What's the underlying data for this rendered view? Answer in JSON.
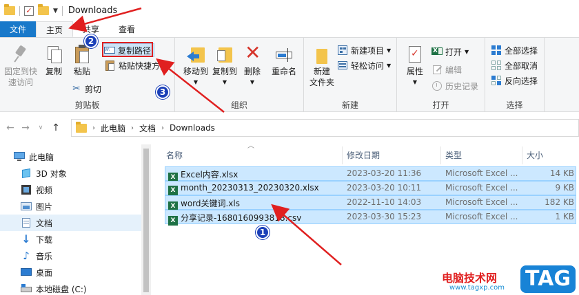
{
  "window": {
    "title": "Downloads"
  },
  "tabs": [
    {
      "label": "文件"
    },
    {
      "label": "主页"
    },
    {
      "label": "共享"
    },
    {
      "label": "查看"
    }
  ],
  "ribbon": {
    "clipboard": {
      "label": "剪贴板",
      "pin": "固定到快速访问",
      "pin_line1": "固定到快",
      "pin_line2": "速访问",
      "copy": "复制",
      "paste": "粘贴",
      "copy_path": "复制路径",
      "paste_shortcut": "粘贴快捷方式",
      "cut": "剪切"
    },
    "organize": {
      "label": "组织",
      "move_to": "移动到",
      "copy_to": "复制到",
      "delete": "删除",
      "rename": "重命名"
    },
    "new": {
      "label": "新建",
      "new_folder_line1": "新建",
      "new_folder_line2": "文件夹",
      "new_item": "新建项目",
      "easy_access": "轻松访问"
    },
    "open": {
      "label": "打开",
      "properties": "属性",
      "open": "打开",
      "edit": "编辑",
      "history": "历史记录"
    },
    "select": {
      "label": "选择",
      "select_all": "全部选择",
      "select_none": "全部取消",
      "invert": "反向选择"
    }
  },
  "address": {
    "crumbs": [
      "此电脑",
      "文档",
      "Downloads"
    ]
  },
  "navpane": {
    "items": [
      {
        "label": "此电脑",
        "icon": "computer-icon"
      },
      {
        "label": "3D 对象",
        "icon": "cube-icon"
      },
      {
        "label": "视频",
        "icon": "video-icon"
      },
      {
        "label": "图片",
        "icon": "picture-icon"
      },
      {
        "label": "文档",
        "icon": "document-icon"
      },
      {
        "label": "下载",
        "icon": "download-icon"
      },
      {
        "label": "音乐",
        "icon": "music-icon"
      },
      {
        "label": "桌面",
        "icon": "desktop-icon"
      },
      {
        "label": "本地磁盘 (C:)",
        "icon": "drive-icon"
      }
    ]
  },
  "filelist": {
    "columns": [
      "名称",
      "修改日期",
      "类型",
      "大小"
    ],
    "rows": [
      {
        "name": "Excel内容.xlsx",
        "date": "2023-03-20 11:36",
        "type": "Microsoft Excel ...",
        "size": "14 KB"
      },
      {
        "name": "month_20230313_20230320.xlsx",
        "date": "2023-03-20 10:11",
        "type": "Microsoft Excel ...",
        "size": "9 KB"
      },
      {
        "name": "word关键词.xls",
        "date": "2022-11-10 14:03",
        "type": "Microsoft Excel ...",
        "size": "182 KB"
      },
      {
        "name": "分享记录-1680160993818.csv",
        "date": "2023-03-30 15:23",
        "type": "Microsoft Excel ...",
        "size": "1 KB"
      }
    ]
  },
  "annotations": {
    "badge1": "1",
    "badge2": "2",
    "badge3": "3",
    "arrow_color": "#e02020",
    "badge_color": "#1a3fb8"
  },
  "watermark": {
    "text": "电脑技术网",
    "url": "www.tagxp.com",
    "tag": "TAG"
  },
  "colors": {
    "file_tab": "#1979ca",
    "selection": "#cce8ff",
    "ribbon_bg": "#f5f6f7"
  }
}
